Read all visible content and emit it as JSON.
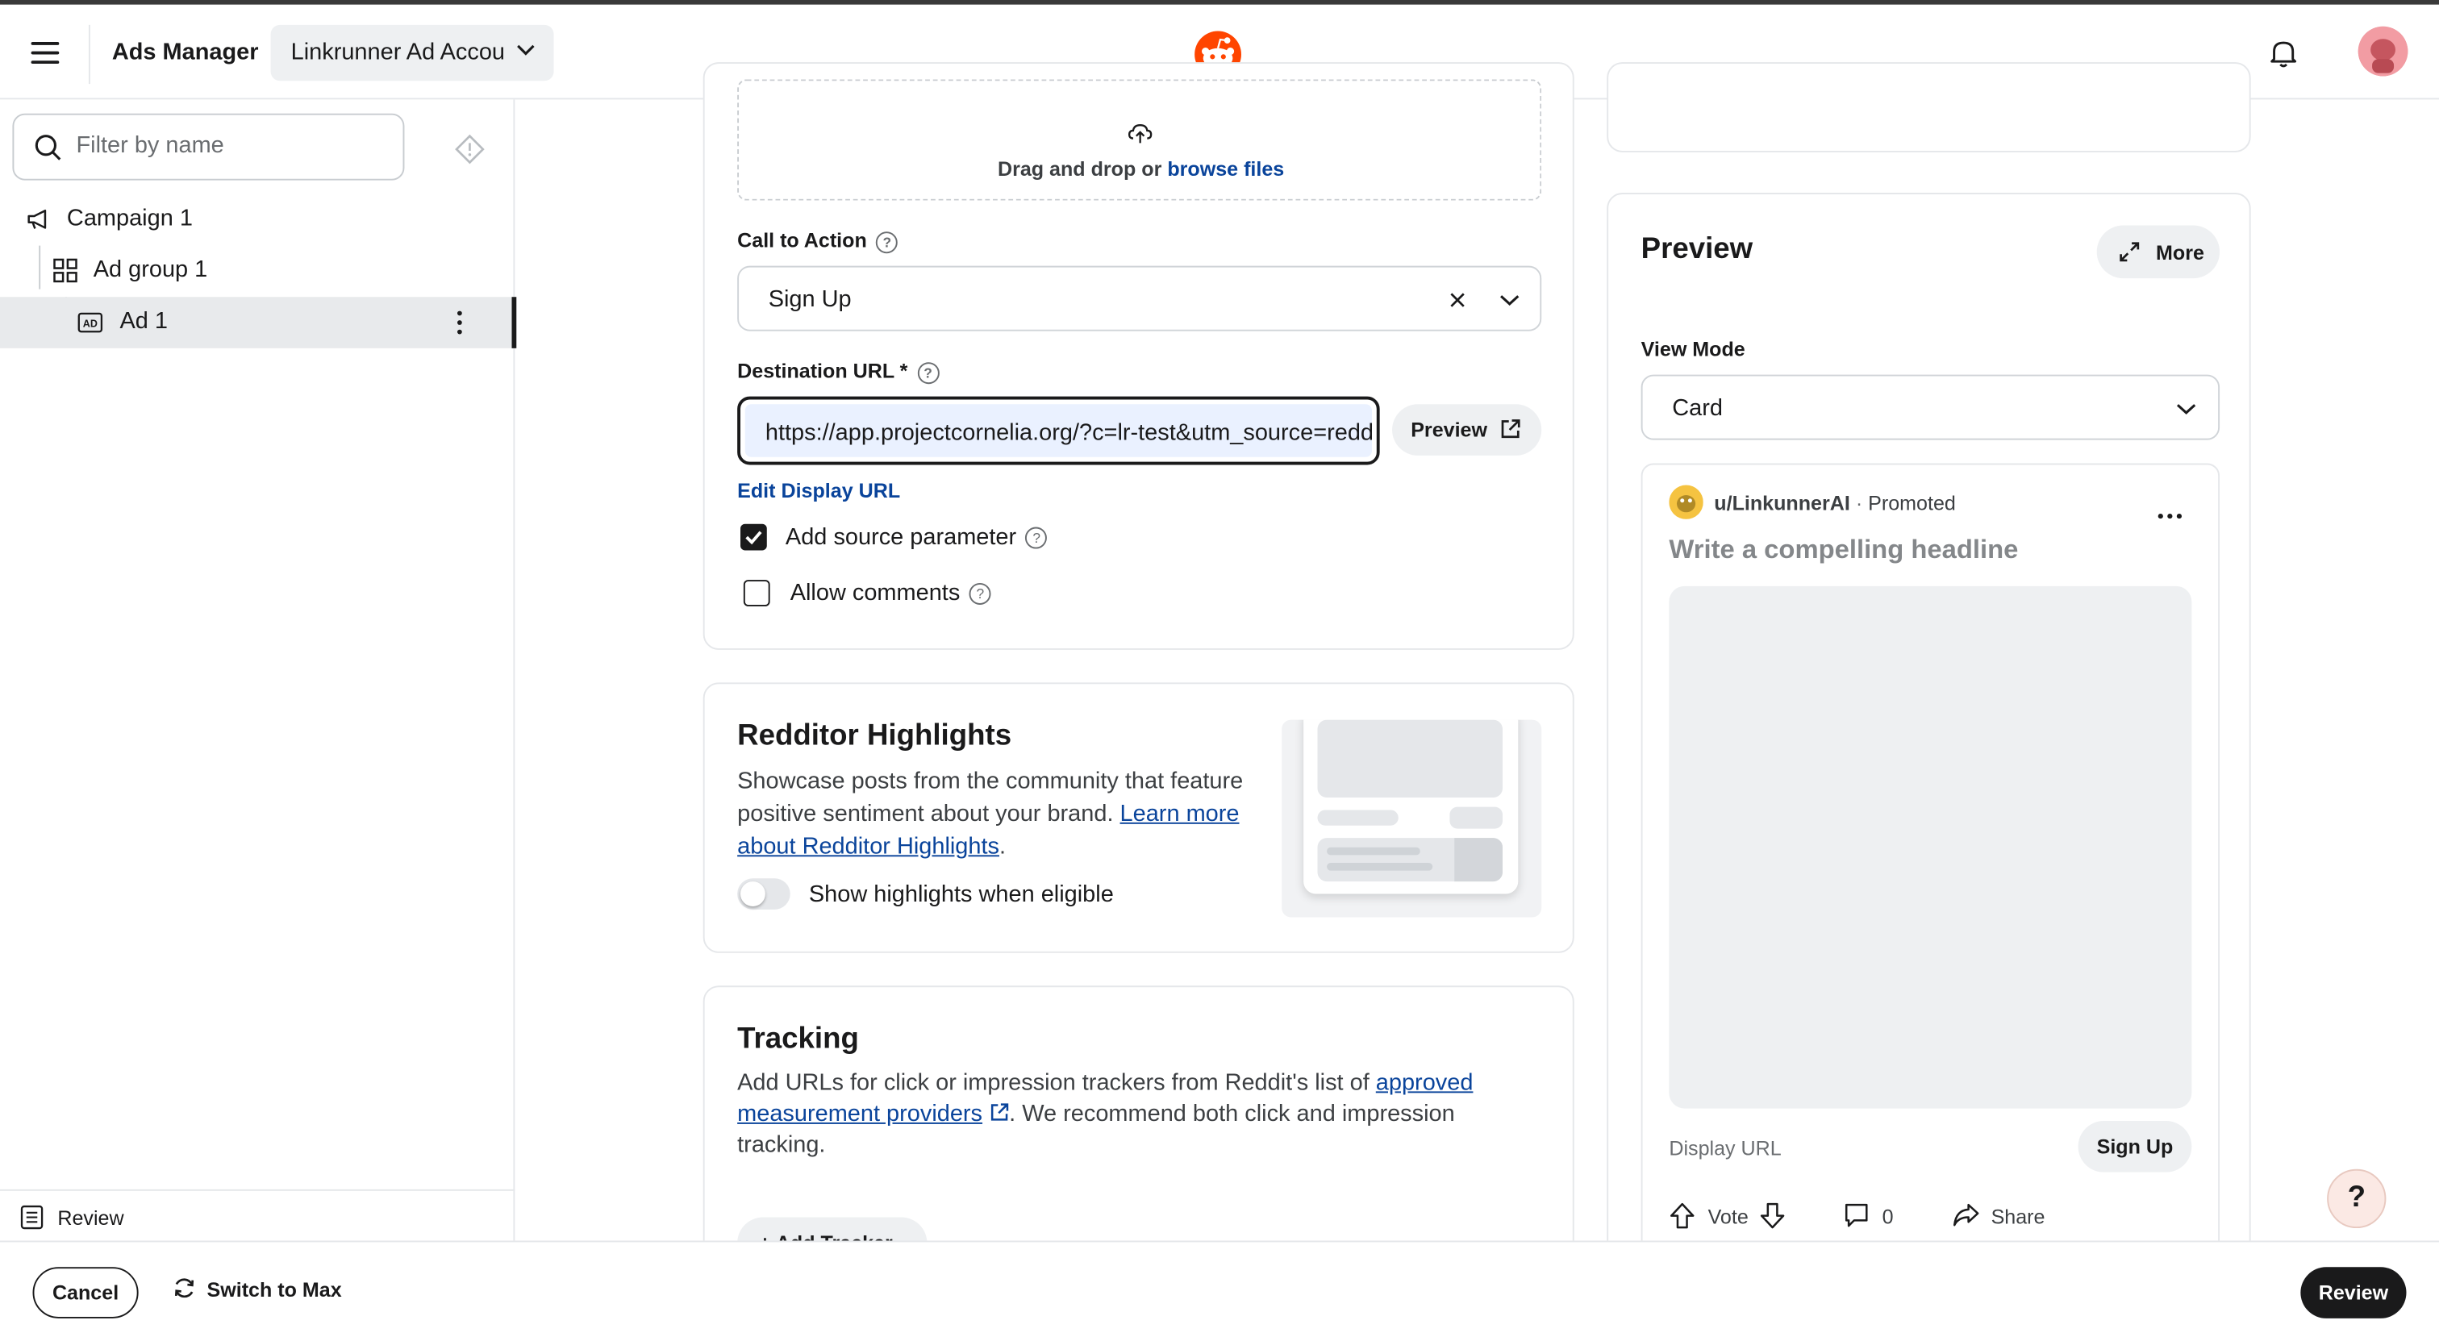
{
  "header": {
    "app_title": "Ads Manager",
    "account_selector": "Linkrunner Ad Account"
  },
  "sidebar": {
    "filter_placeholder": "Filter by name",
    "tree": [
      {
        "label": "Campaign 1"
      },
      {
        "label": "Ad group 1"
      },
      {
        "label": "Ad 1"
      }
    ],
    "review_label": "Review"
  },
  "upload": {
    "drag_text": "Drag and drop or",
    "browse_link": "browse files"
  },
  "cta": {
    "label": "Call to Action",
    "value": "Sign Up"
  },
  "destination": {
    "label": "Destination URL *",
    "value": "https://app.projectcornelia.org/?c=lr-test&utm_source=reddit",
    "preview_button": "Preview",
    "edit_display_url": "Edit Display URL",
    "add_source_label": "Add source parameter",
    "add_source_checked": true,
    "allow_comments_label": "Allow comments",
    "allow_comments_checked": false
  },
  "highlights": {
    "title": "Redditor Highlights",
    "desc_1": "Showcase posts from the community that feature positive sentiment about your brand.",
    "learn_more": "Learn more about Redditor Highlights",
    "period": ".",
    "toggle_label": "Show highlights when eligible",
    "toggle_on": false
  },
  "tracking": {
    "title": "Tracking",
    "desc_1": "Add URLs for click or impression trackers from Reddit's list of",
    "link": "approved measurement providers",
    "desc_2": ". We recommend both click and impression tracking.",
    "add_tracker": "+ Add Tracker"
  },
  "preview": {
    "title": "Preview",
    "more_button": "More",
    "view_mode_label": "View Mode",
    "view_mode_value": "Card",
    "username": "u/LinkunnerAI",
    "promoted": "Promoted",
    "headline_placeholder": "Write a compelling headline",
    "display_url": "Display URL",
    "cta_button": "Sign Up",
    "vote_label": "Vote",
    "comments_count": "0",
    "share_label": "Share"
  },
  "footer": {
    "cancel": "Cancel",
    "switch_to_max": "Switch to Max",
    "review": "Review"
  },
  "help_fab": "?",
  "colors": {
    "accent_link": "#0a449b",
    "reddit_orange": "#ff4500",
    "primary_dark": "#1a1a1b"
  }
}
